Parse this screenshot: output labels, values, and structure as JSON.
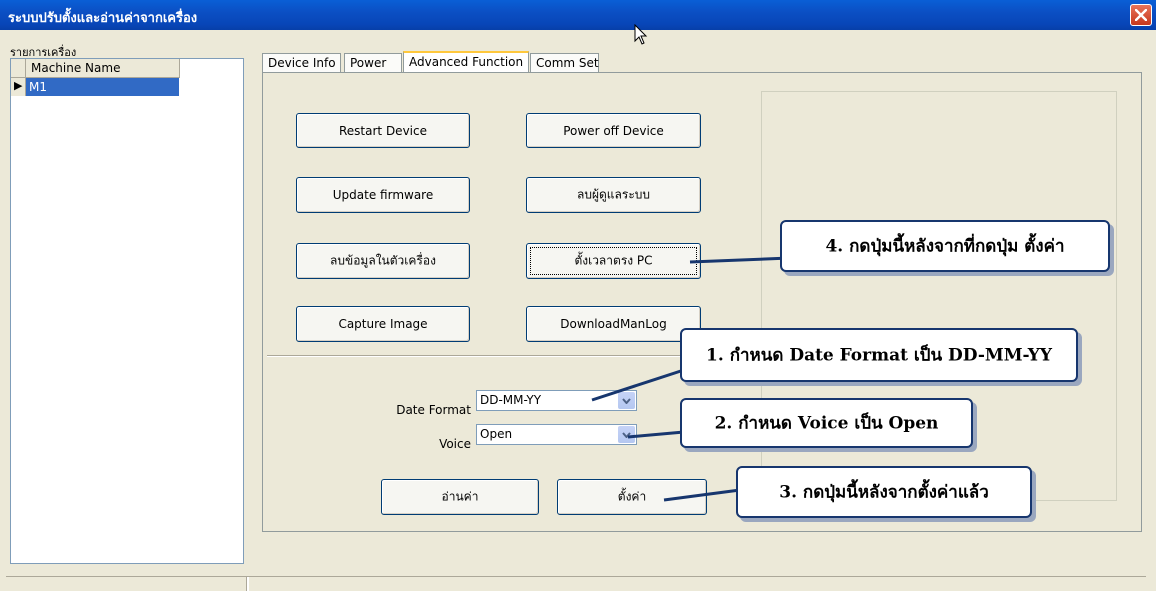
{
  "window": {
    "title": "ระบบปรับตั้งและอ่านค่าจากเครื่อง",
    "close_icon": "close-icon"
  },
  "machine_list": {
    "group_label": "รายการเครื่อง",
    "column_header": "Machine Name",
    "rows": [
      {
        "indicator": "▶",
        "name": "M1",
        "selected": true
      }
    ]
  },
  "tabs": [
    {
      "label": "Device Info",
      "active": false
    },
    {
      "label": "Power",
      "active": false
    },
    {
      "label": "Advanced Function",
      "active": true
    },
    {
      "label": "Comm Set",
      "active": false
    }
  ],
  "buttons": {
    "restart_device": "Restart Device",
    "power_off_device": "Power off Device",
    "update_firmware": "Update firmware",
    "delete_admin": "ลบผู้ดูแลระบบ",
    "delete_device_data": "ลบข้อมูลในตัวเครื่อง",
    "sync_time_pc": "ตั้งเวลาตรง PC",
    "capture_image": "Capture Image",
    "download_man_log": "DownloadManLog",
    "read_values": "อ่านค่า",
    "set_values": "ตั้งค่า"
  },
  "settings": {
    "date_format_label": "Date Format",
    "date_format_value": "DD-MM-YY",
    "voice_label": "Voice",
    "voice_value": "Open"
  },
  "callouts": {
    "step1": "1. กำหนด Date Format เป็น DD-MM-YY",
    "step2": "2. กำหนด Voice เป็น Open",
    "step3": "3. กดปุ่มนี้หลังจากตั้งค่าแล้ว",
    "step4": "4. กดปุ่มนี้หลังจากที่กดปุ่ม ตั้งค่า"
  },
  "colors": {
    "titlebar": "#0b4fc4",
    "selection": "#316ac5",
    "callout_border": "#17366e",
    "close_button": "#c7371c"
  }
}
